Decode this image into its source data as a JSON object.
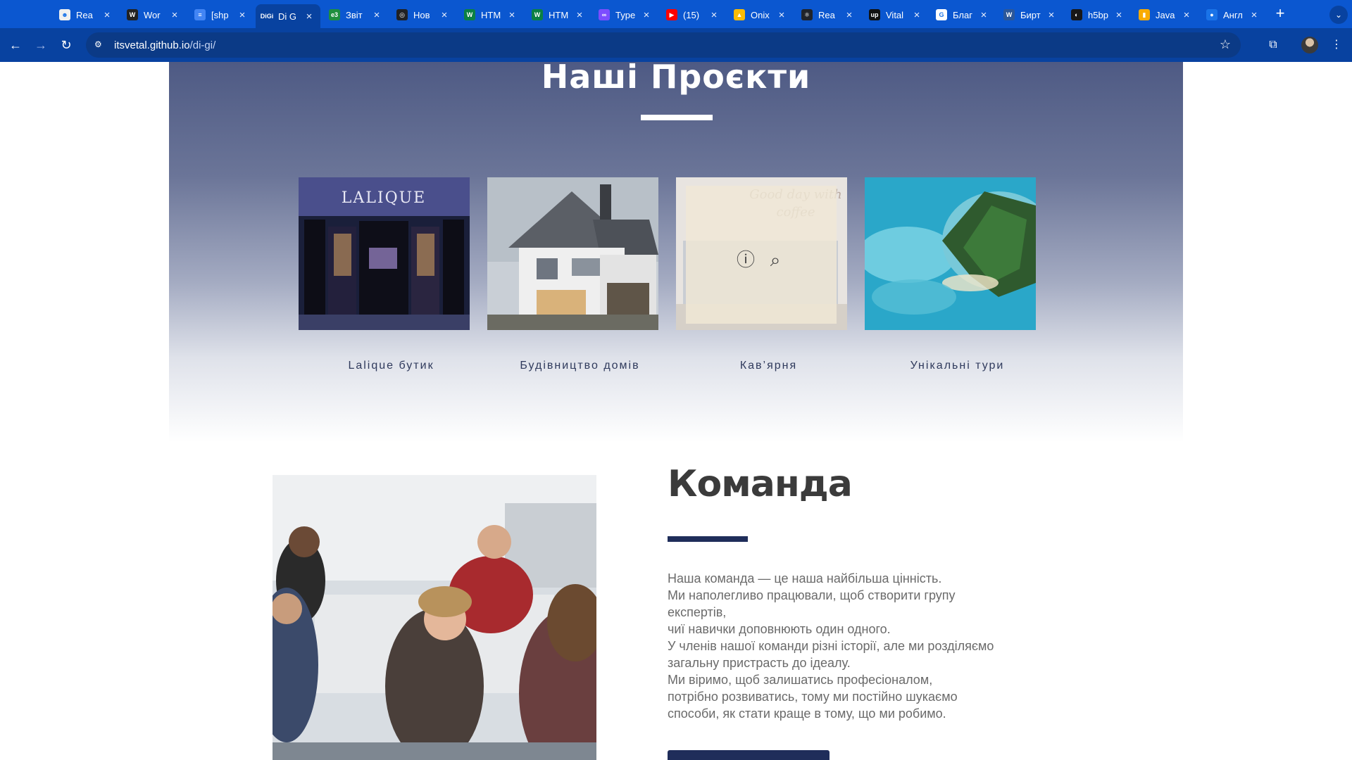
{
  "browser": {
    "tabs": [
      {
        "title": "Rea",
        "fav_color": "#f0f0f0",
        "fav_text": "☻"
      },
      {
        "title": "Wor",
        "fav_color": "#222222",
        "fav_text": "W"
      },
      {
        "title": "[shp",
        "fav_color": "#4285f4",
        "fav_text": "≡"
      },
      {
        "title": "Di G",
        "fav_color": "#0842a0",
        "fav_text": "DiGi"
      },
      {
        "title": "Звіт",
        "fav_color": "#1e8e3e",
        "fav_text": "e3"
      },
      {
        "title": "Нов",
        "fav_color": "#202124",
        "fav_text": "◎"
      },
      {
        "title": "HTM",
        "fav_color": "#0b8043",
        "fav_text": "W"
      },
      {
        "title": "HTM",
        "fav_color": "#0b8043",
        "fav_text": "W"
      },
      {
        "title": "Type",
        "fav_color": "#7c4dff",
        "fav_text": "∞"
      },
      {
        "title": "(15)",
        "fav_color": "#ff0000",
        "fav_text": "▶"
      },
      {
        "title": "Onix",
        "fav_color": "#fbbc04",
        "fav_text": "▲"
      },
      {
        "title": "Rea",
        "fav_color": "#20232a",
        "fav_text": "⚛"
      },
      {
        "title": "Vital",
        "fav_color": "#111111",
        "fav_text": "up"
      },
      {
        "title": "Благ",
        "fav_color": "#ffffff",
        "fav_text": "G"
      },
      {
        "title": "Бирт",
        "fav_color": "#2b579a",
        "fav_text": "W"
      },
      {
        "title": "h5bp",
        "fav_color": "#181717",
        "fav_text": "◐"
      },
      {
        "title": "Java",
        "fav_color": "#f9ab00",
        "fav_text": "▮"
      },
      {
        "title": "Англ",
        "fav_color": "#1a73e8",
        "fav_text": "●"
      }
    ],
    "url_host": "itsvetal.github.io",
    "url_path": "/di-gi/"
  },
  "projects": {
    "title": "Наші Проєкти",
    "items": [
      {
        "caption": "Lalique бутик"
      },
      {
        "caption": "Будівництво домів"
      },
      {
        "caption": "Кав’ярня"
      },
      {
        "caption": "Унікальні тури"
      }
    ],
    "card3_overlay_text": "Good day with coffee",
    "lalique_sign": "LALIQUE"
  },
  "team": {
    "title": "Команда",
    "lines": [
      "Наша команда — це наша найбільша цінність.",
      "Ми наполегливо працювали, щоб створити групу",
      "експертів,",
      "чиї навички доповнюють один одного.",
      "У членів нашої команди різні історії, але ми розділяємо",
      "загальну пристрасть до ідеалу.",
      "Ми віримо, щоб залишатись професіоналом,",
      "потрібно розвиватись, тому ми постійно шукаємо",
      "способи, як стати краще в тому, що ми робимо."
    ]
  },
  "colors": {
    "chrome_blue": "#0b57d0",
    "toolbar_blue": "#0842a0",
    "navy_accent": "#1f2d5a"
  }
}
